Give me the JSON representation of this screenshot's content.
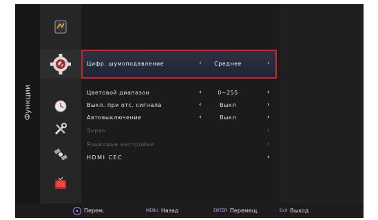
{
  "sidebar": {
    "title": "Функции"
  },
  "menu": {
    "highlight": {
      "label": "Цифр. шумоподавление",
      "value": "Среднее",
      "left_arrow": "‹",
      "right_arrow": "›"
    },
    "rows": [
      {
        "label": "Цветовой диапазон",
        "value": "0~255",
        "left_arrow": "‹",
        "right_arrow": "›"
      },
      {
        "label": "Выкл. при отс. сигнала",
        "value": "Выкл",
        "left_arrow": "‹",
        "right_arrow": "›"
      },
      {
        "label": "Автовыключение",
        "value": "Выкл",
        "left_arrow": "‹",
        "right_arrow": "›"
      },
      {
        "label": "Экран",
        "right_arrow": "›"
      },
      {
        "label": "Языковые настройки",
        "right_arrow": "›"
      },
      {
        "label": "HDMI CEC",
        "right_arrow": "›"
      }
    ]
  },
  "footer": {
    "move": {
      "key": "",
      "label": "Перем."
    },
    "back": {
      "key": "MENU",
      "label": "Назад"
    },
    "select": {
      "key": "ENTER",
      "label": "Перемещ."
    },
    "exit": {
      "key": "Exit",
      "label": "Выход"
    }
  },
  "icons": [
    "picture-icon",
    "settings-gear-icon",
    "clock-icon",
    "tools-icon",
    "satellite-icon",
    "tv-icon"
  ]
}
